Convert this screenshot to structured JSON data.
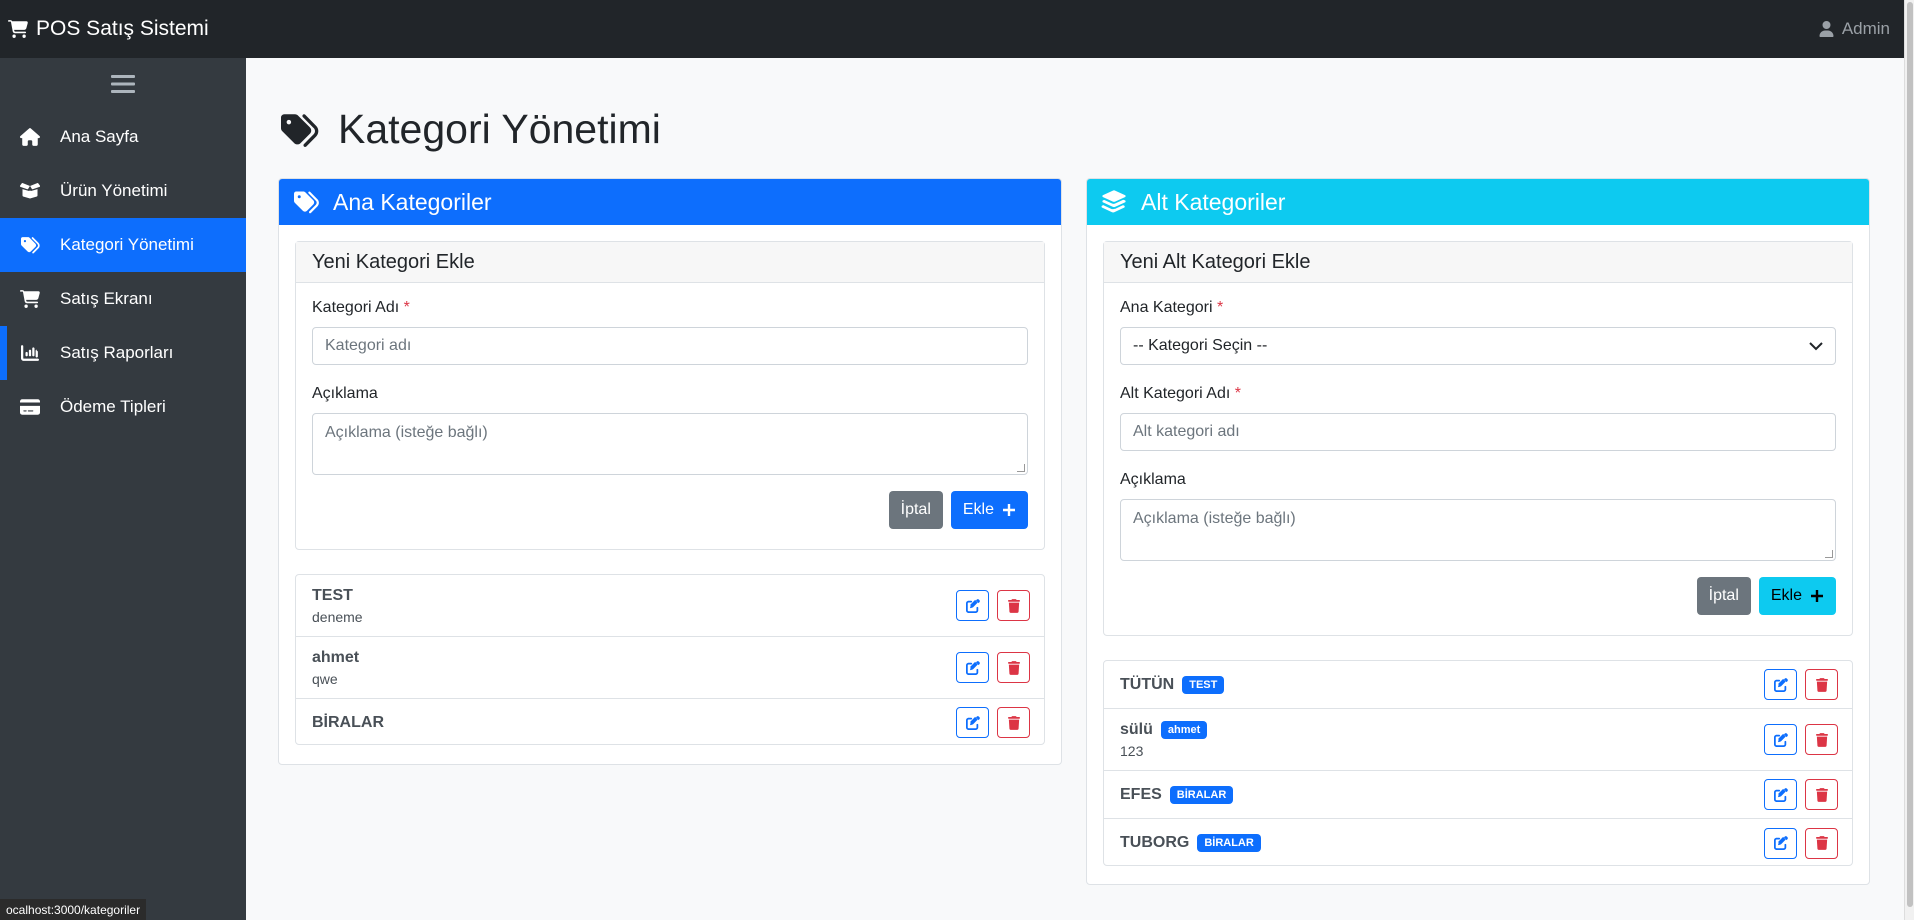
{
  "app": {
    "brand": "POS Satış Sistemi",
    "user": "Admin"
  },
  "sidebar": {
    "items": [
      {
        "label": "Ana Sayfa",
        "icon": "home-icon"
      },
      {
        "label": "Ürün Yönetimi",
        "icon": "box-icon"
      },
      {
        "label": "Kategori Yönetimi",
        "icon": "tags-icon",
        "active": true
      },
      {
        "label": "Satış Ekranı",
        "icon": "cart-icon"
      },
      {
        "label": "Satış Raporları",
        "icon": "chart-icon"
      },
      {
        "label": "Ödeme Tipleri",
        "icon": "credit-card-icon"
      }
    ]
  },
  "page": {
    "title": "Kategori Yönetimi"
  },
  "left": {
    "header": "Ana Kategoriler",
    "form_title": "Yeni Kategori Ekle",
    "name_label": "Kategori Adı",
    "name_placeholder": "Kategori adı",
    "desc_label": "Açıklama",
    "desc_placeholder": "Açıklama (isteğe bağlı)",
    "cancel": "İptal",
    "add": "Ekle",
    "items": [
      {
        "name": "TEST",
        "desc": "deneme"
      },
      {
        "name": "ahmet",
        "desc": "qwe"
      },
      {
        "name": "BİRALAR",
        "desc": ""
      }
    ]
  },
  "right": {
    "header": "Alt Kategoriler",
    "form_title": "Yeni Alt Kategori Ekle",
    "parent_label": "Ana Kategori",
    "parent_value": "-- Kategori Seçin --",
    "name_label": "Alt Kategori Adı",
    "name_placeholder": "Alt kategori adı",
    "desc_label": "Açıklama",
    "desc_placeholder": "Açıklama (isteğe bağlı)",
    "cancel": "İptal",
    "add": "Ekle",
    "items": [
      {
        "name": "TÜTÜN",
        "badge": "TEST",
        "desc": ""
      },
      {
        "name": "sülü",
        "badge": "ahmet",
        "desc": "123"
      },
      {
        "name": "EFES",
        "badge": "BİRALAR",
        "desc": ""
      },
      {
        "name": "TUBORG",
        "badge": "BİRALAR",
        "desc": ""
      }
    ]
  },
  "status_url": "ocalhost:3000/kategoriler",
  "colors": {
    "primary": "#0d6efd",
    "info": "#0dcaf0",
    "danger": "#dc3545",
    "sidebar": "#343a40",
    "navbar": "#212529"
  }
}
